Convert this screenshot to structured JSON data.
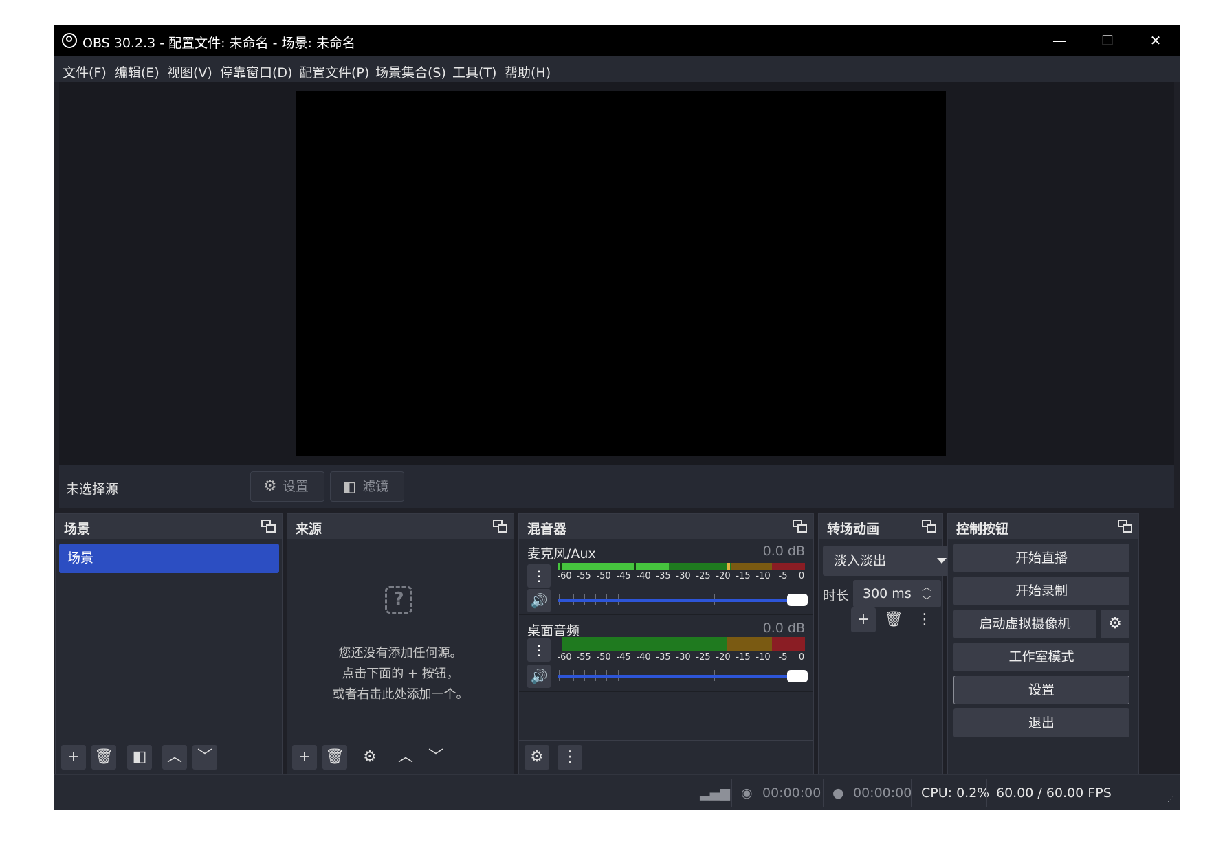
{
  "window": {
    "title": "OBS 30.2.3 - 配置文件: 未命名 - 场景: 未命名",
    "controls": {
      "minimize": "—",
      "maximize": "☐",
      "close": "✕"
    }
  },
  "menu": [
    "文件(F)",
    "编辑(E)",
    "视图(V)",
    "停靠窗口(D)",
    "配置文件(P)",
    "场景集合(S)",
    "工具(T)",
    "帮助(H)"
  ],
  "source_toolbar": {
    "no_source": "未选择源",
    "settings": "设置",
    "filters": "滤镜"
  },
  "docks": {
    "scenes": {
      "title": "场景",
      "items": [
        "场景"
      ]
    },
    "sources": {
      "title": "来源",
      "empty_lines": [
        "您还没有添加任何源。",
        "点击下面的 + 按钮，",
        "或者右击此处添加一个。"
      ]
    },
    "mixer": {
      "title": "混音器",
      "channels": [
        {
          "name": "麦克风/Aux",
          "level": "0.0 dB"
        },
        {
          "name": "桌面音频",
          "level": "0.0 dB"
        }
      ],
      "ticks": [
        "-60",
        "-55",
        "-50",
        "-45",
        "-40",
        "-35",
        "-30",
        "-25",
        "-20",
        "-15",
        "-10",
        "-5",
        "0"
      ]
    },
    "transitions": {
      "title": "转场动画",
      "selected": "淡入淡出",
      "duration_label": "时长",
      "duration": "300 ms"
    },
    "controls": {
      "title": "控制按钮",
      "start_streaming": "开始直播",
      "start_recording": "开始录制",
      "start_virtualcam": "启动虚拟摄像机",
      "studio_mode": "工作室模式",
      "settings": "设置",
      "exit": "退出"
    }
  },
  "status": {
    "stream_time": "00:00:00",
    "record_time": "00:00:00",
    "cpu": "CPU: 0.2%",
    "fps": "60.00 / 60.00 FPS"
  },
  "colors": {
    "accent": "#2c4ec2",
    "background": "#1f2027",
    "meter_green": "#46c43e",
    "meter_yellow": "#c9a227",
    "meter_red": "#c0343b"
  }
}
